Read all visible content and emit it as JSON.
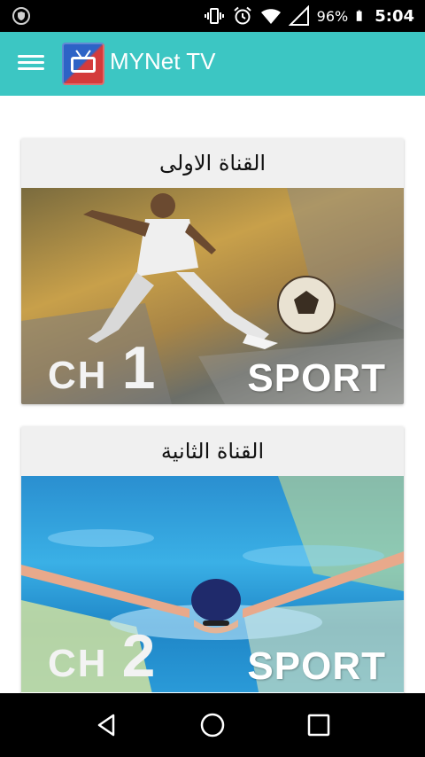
{
  "status_bar": {
    "battery_percent": "96%",
    "time": "5:04",
    "icons": [
      "shield-icon",
      "vibrate-icon",
      "alarm-icon",
      "wifi-icon",
      "signal-icon",
      "battery-icon"
    ]
  },
  "app_bar": {
    "title": "MYNet TV",
    "menu_icon": "hamburger-menu-icon",
    "logo": "tv-logo-icon"
  },
  "channels": [
    {
      "title": "القناة الاولى",
      "image_ch_text": "CH",
      "image_ch_number": "1",
      "image_sport_text": "SPORT"
    },
    {
      "title": "القناة الثانية",
      "image_ch_text": "CH",
      "image_ch_number": "2",
      "image_sport_text": "SPORT"
    }
  ],
  "nav_bar": {
    "back_icon": "back-icon",
    "home_icon": "home-icon",
    "recents_icon": "recents-icon"
  },
  "colors": {
    "app_bar": "#3cc6c3",
    "status_bar": "#000000",
    "nav_bar": "#000000",
    "card_header": "#f0f0f0"
  }
}
